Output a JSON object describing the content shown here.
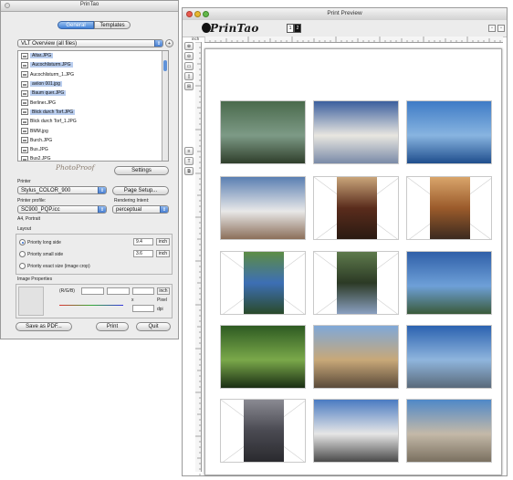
{
  "left_window": {
    "title": "PrinTao",
    "tabs": [
      {
        "label": "General",
        "active": true
      },
      {
        "label": "Templates",
        "active": false
      }
    ],
    "folder_select": "VLT Overview (all files)",
    "files": [
      {
        "name": "Altar.JPG",
        "selected": true
      },
      {
        "name": "Aucochlisturm.JPG",
        "selected": true
      },
      {
        "name": "Aucochlisturm_1.JPG",
        "selected": false
      },
      {
        "name": "aviion 001.jpg",
        "selected": true
      },
      {
        "name": "Baum quer.JPG",
        "selected": true
      },
      {
        "name": "Berliner.JPG",
        "selected": false
      },
      {
        "name": "Blick durch Torf.JPG",
        "selected": true
      },
      {
        "name": "Blick durch Torf_1.JPG",
        "selected": false
      },
      {
        "name": "BMM.jpg",
        "selected": false
      },
      {
        "name": "Burch.JPG",
        "selected": false
      },
      {
        "name": "Bus.JPG",
        "selected": false
      },
      {
        "name": "Bus2.JPG",
        "selected": false
      }
    ],
    "photoproof_logo": "PhotoProof",
    "settings_button": "Settings",
    "printer_label": "Printer",
    "printer_value": "Stylus_COLOR_900",
    "page_setup_button": "Page Setup...",
    "profile_label": "Printer profile:",
    "profile_value": "SC900_PQP.icc",
    "intent_label": "Rendering Intent:",
    "intent_value": "perceptual",
    "paper_info": "A4, Portrait",
    "layout_label": "Layout",
    "layout_options": [
      {
        "label": "Priority  long side",
        "value": "9.4",
        "unit": "inch",
        "selected": true
      },
      {
        "label": "Priority  small side",
        "value": "3.6",
        "unit": "inch",
        "selected": false
      },
      {
        "label": "Priority  exact size (image crop)",
        "value": "",
        "unit": "",
        "selected": false
      }
    ],
    "image_props_label": "Image Properties",
    "rgb_label": "(R/G/B)",
    "unit_inch": "inch",
    "pixel_label": "Pixel",
    "x_label": "x",
    "dpi_label": "dpi",
    "save_pdf_button": "Save as PDF...",
    "print_button": "Print",
    "quit_button": "Quit"
  },
  "right_window": {
    "title": "Print Preview",
    "logo_text": "PrinTao",
    "page_indicator": [
      "1",
      "2"
    ],
    "ruler_unit": "inch",
    "sidebar_buttons": [
      "⊕",
      "⊖",
      "▭",
      "▯",
      "⊞",
      "≡",
      "T",
      "⧉"
    ],
    "thumbnails": [
      {
        "name": "agave plant",
        "orientation": "landscape",
        "colors": [
          "#4a6a4c",
          "#7d9a86",
          "#2f3e2b"
        ]
      },
      {
        "name": "airplane",
        "orientation": "landscape",
        "colors": [
          "#3b5f9e",
          "#e8e6e0",
          "#7a8aa8"
        ]
      },
      {
        "name": "seaplane",
        "orientation": "landscape",
        "colors": [
          "#3e7bc6",
          "#88b4e0",
          "#1f4e8d"
        ]
      },
      {
        "name": "airplane hangar",
        "orientation": "landscape",
        "colors": [
          "#5a7fb2",
          "#e8e8e8",
          "#8b6f5a"
        ]
      },
      {
        "name": "interior doorway",
        "orientation": "portrait",
        "colors": [
          "#5a2c1c",
          "#c9a57a",
          "#2a1a12"
        ]
      },
      {
        "name": "archway",
        "orientation": "portrait",
        "colors": [
          "#9b5b2b",
          "#d9a56b",
          "#3b2a1f"
        ]
      },
      {
        "name": "mountain coast",
        "orientation": "portrait",
        "colors": [
          "#3d6fb5",
          "#5d8c45",
          "#2a4a2a"
        ]
      },
      {
        "name": "tree",
        "orientation": "portrait",
        "colors": [
          "#2c3a25",
          "#5e7a4c",
          "#8aa0c0"
        ]
      },
      {
        "name": "coastline",
        "orientation": "landscape",
        "colors": [
          "#2f5fa8",
          "#6ea0d8",
          "#3a5a3a"
        ]
      },
      {
        "name": "leaves and flower",
        "orientation": "landscape",
        "colors": [
          "#2e5b22",
          "#7aa84a",
          "#1a2e14"
        ]
      },
      {
        "name": "building",
        "orientation": "landscape",
        "colors": [
          "#7fa8d8",
          "#c8a878",
          "#5a4a3a"
        ]
      },
      {
        "name": "harbour",
        "orientation": "landscape",
        "colors": [
          "#2b62b0",
          "#8fb5dd",
          "#5a6a7a"
        ]
      },
      {
        "name": "street",
        "orientation": "portrait",
        "colors": [
          "#4a4a52",
          "#8a8a92",
          "#2a2a2e"
        ]
      },
      {
        "name": "ship",
        "orientation": "landscape",
        "colors": [
          "#4a7bc2",
          "#e6e6e6",
          "#4a4a4a"
        ]
      },
      {
        "name": "aerial port",
        "orientation": "landscape",
        "colors": [
          "#4f88c8",
          "#c4b9a8",
          "#7a7060"
        ]
      }
    ]
  }
}
